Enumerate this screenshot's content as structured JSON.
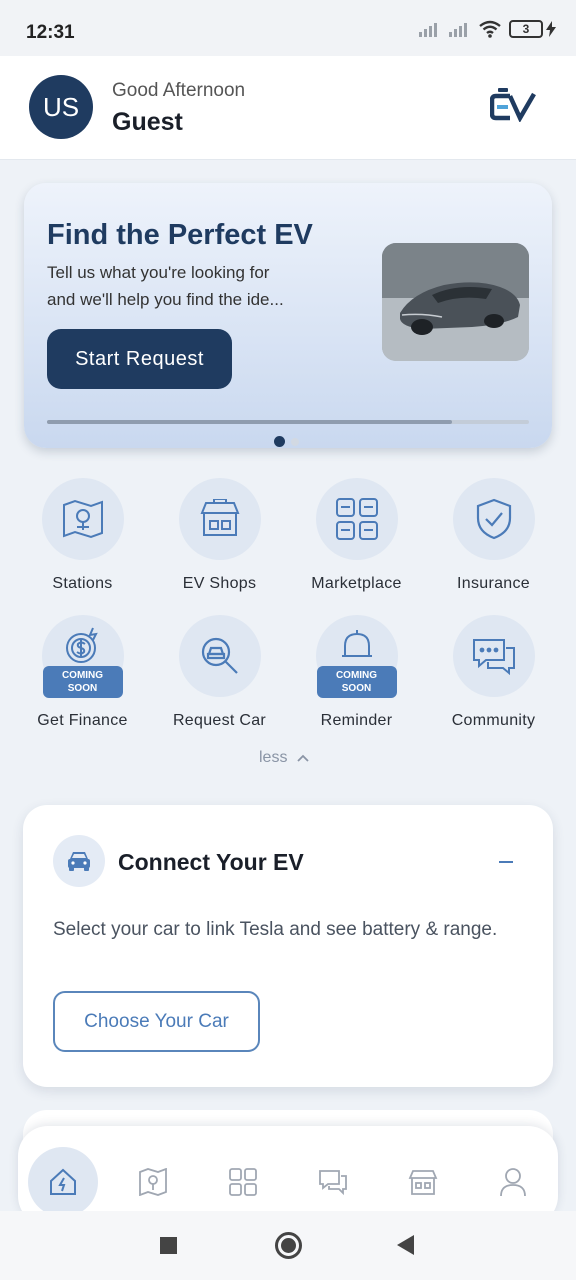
{
  "status_bar": {
    "time": "12:31",
    "battery": "3"
  },
  "header": {
    "avatar_initials": "US",
    "greeting": "Good Afternoon",
    "user_name": "Guest",
    "logo_text": "EV"
  },
  "banner": {
    "title": "Find the Perfect EV",
    "description_line1": "Tell us what you're looking for",
    "description_line2": "and we'll help you find the ide...",
    "button_label": "Start Request",
    "carousel_progress": 0.84,
    "page_count": 2,
    "active_page": 1
  },
  "quick_actions": [
    {
      "label": "Stations",
      "icon": "map-station-icon"
    },
    {
      "label": "EV Shops",
      "icon": "shop-icon"
    },
    {
      "label": "Marketplace",
      "icon": "marketplace-grid-icon"
    },
    {
      "label": "Insurance",
      "icon": "shield-check-icon"
    },
    {
      "label": "Get Finance",
      "icon": "finance-coin-icon",
      "badge": "COMING SOON"
    },
    {
      "label": "Request Car",
      "icon": "search-car-icon"
    },
    {
      "label": "Reminder",
      "icon": "bell-icon",
      "badge": "COMING SOON"
    },
    {
      "label": "Community",
      "icon": "chat-icon"
    }
  ],
  "less_toggle": "less",
  "connect_card": {
    "title": "Connect Your EV",
    "description": "Select your car to link Tesla and see battery & range.",
    "button_label": "Choose Your Car"
  },
  "bottom_nav": [
    "home-icon",
    "map-icon",
    "marketplace-icon",
    "chat-icon",
    "shop-icon",
    "profile-icon"
  ],
  "colors": {
    "primary": "#1f3b60",
    "accent": "#4b7bb8",
    "icon_bg": "#dfe7f2"
  }
}
